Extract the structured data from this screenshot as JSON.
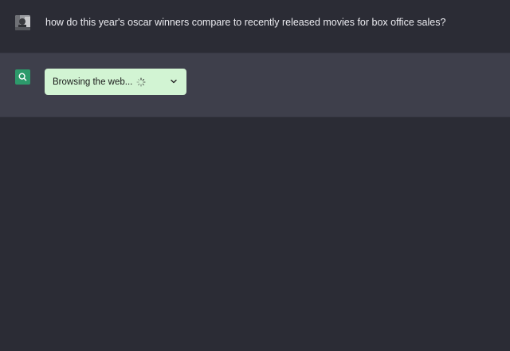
{
  "conversation": {
    "user_message": {
      "avatar_icon": "user-avatar-photo",
      "text": "how do this year's oscar winners compare to recently released movies for box office sales?"
    },
    "assistant_message": {
      "icon": "search-icon",
      "icon_color": "#2d9a6b",
      "browsing_status": {
        "label": "Browsing the web...",
        "spinner_icon": "loading-spinner-icon",
        "expand_icon": "chevron-down-icon",
        "background": "#d2f4d3"
      }
    }
  },
  "colors": {
    "page_background": "#2b2c35",
    "assistant_row_background": "#3e3f4b",
    "text": "#ececf1"
  }
}
